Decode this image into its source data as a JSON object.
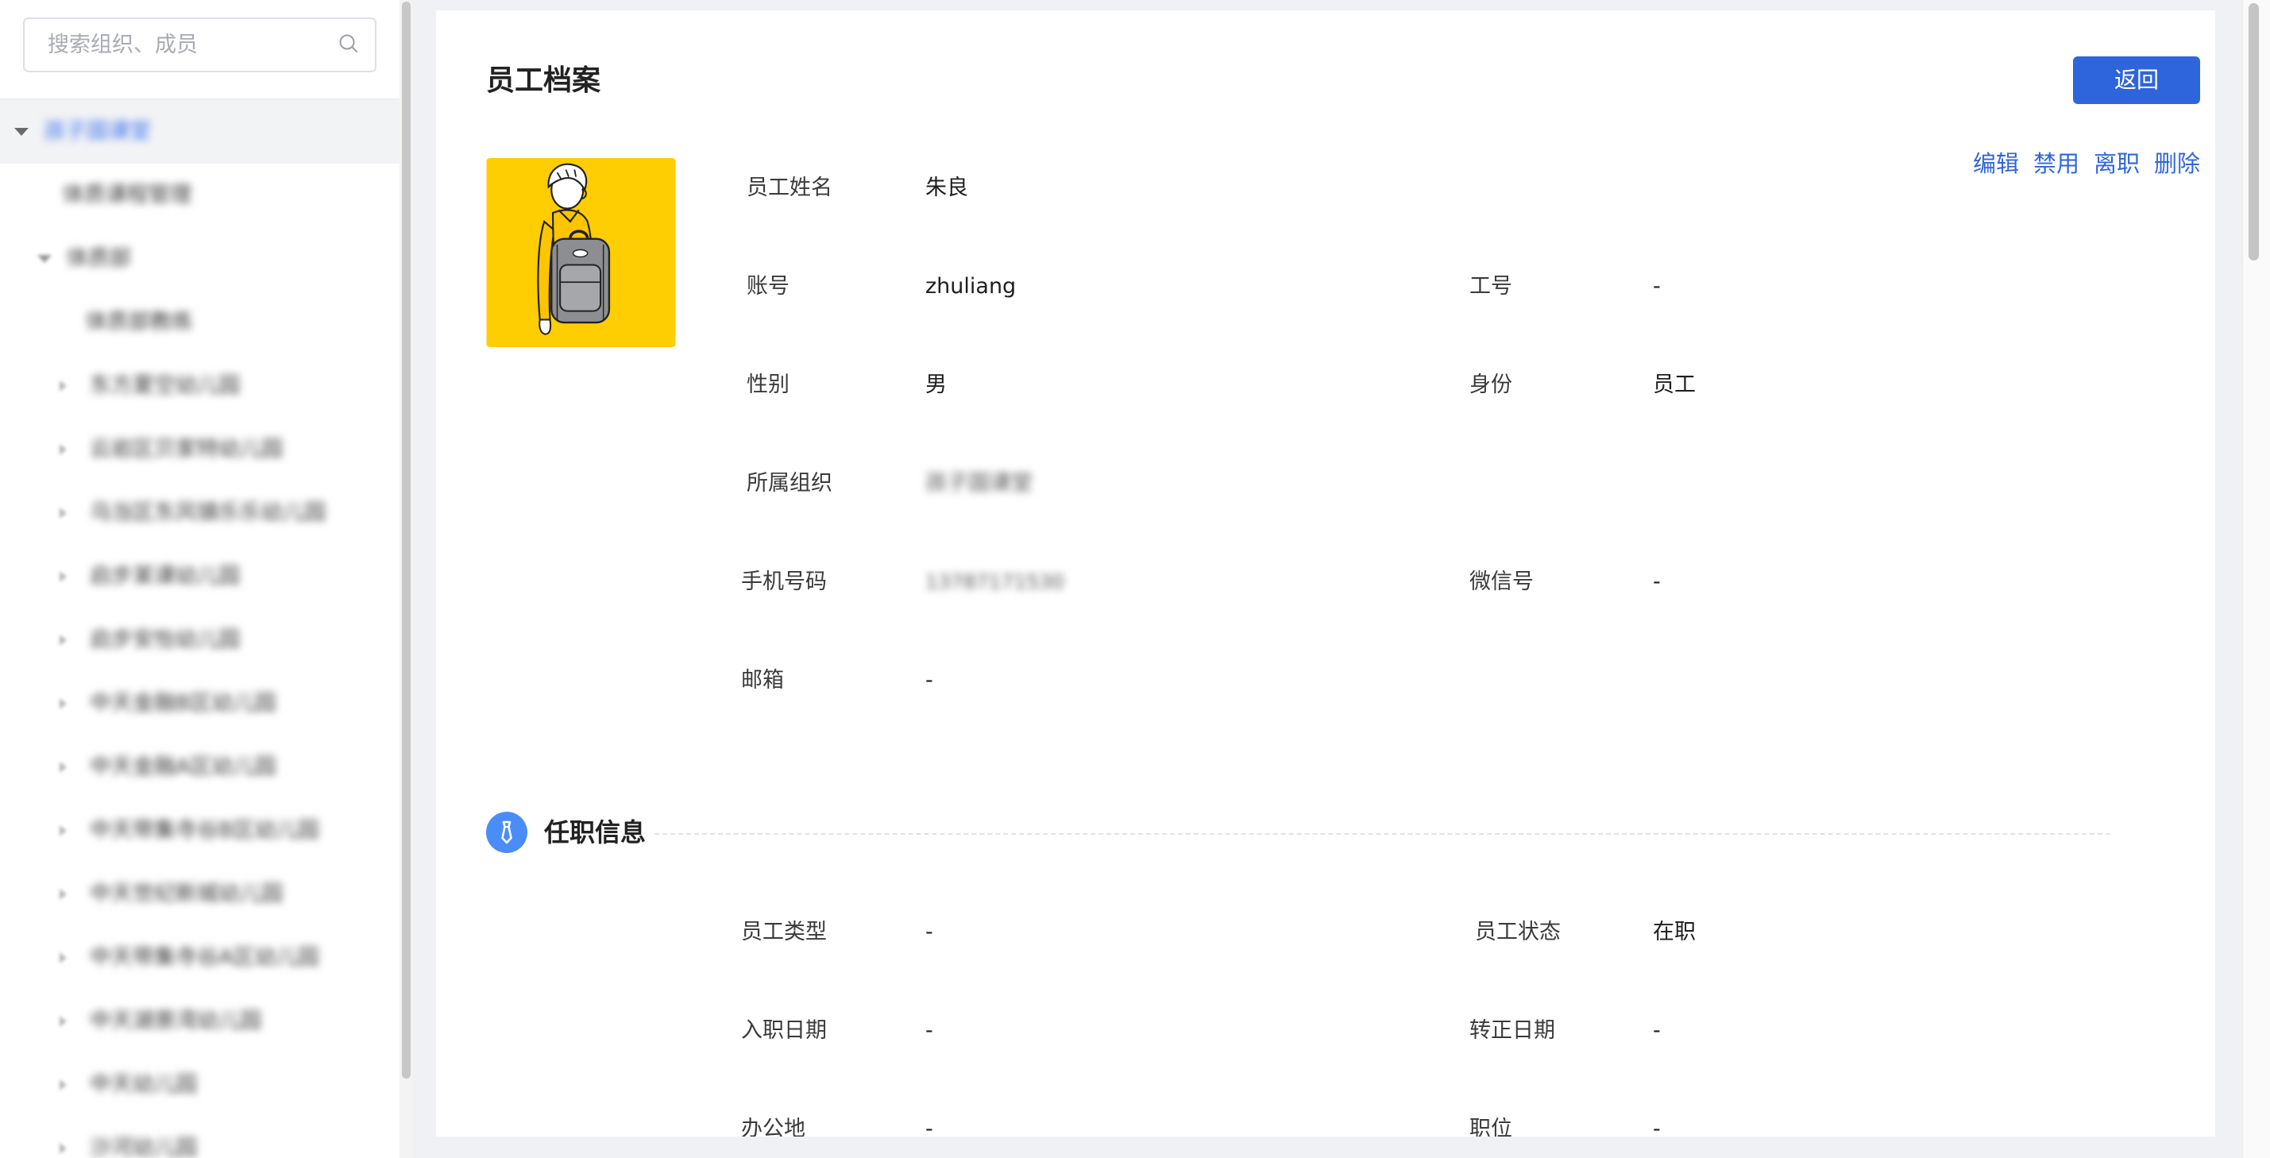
{
  "colors": {
    "primary": "#2f65dc",
    "section_icon": "#4b8df8",
    "avatar_bg": "#fecd02",
    "selected_node_text": "#3d72ee"
  },
  "sidebar": {
    "search": {
      "placeholder": "搜索组织、成员",
      "icon": "search-icon"
    },
    "tree": [
      {
        "label": "孩子国课堂",
        "level": 0,
        "has_children": true,
        "expanded": true,
        "selected": true
      },
      {
        "label": "体质课程管理",
        "level": 1,
        "has_children": false
      },
      {
        "label": "体质部",
        "level": 1,
        "has_children": true,
        "expanded": true
      },
      {
        "label": "体质部教练",
        "level": 2,
        "has_children": false
      },
      {
        "label": "东方夏空幼儿园",
        "level": 2,
        "has_children": true,
        "expanded": false
      },
      {
        "label": "云岩区贝家特幼儿园",
        "level": 2,
        "has_children": true,
        "expanded": false
      },
      {
        "label": "乌当区东风镇乐乐幼儿园",
        "level": 2,
        "has_children": true,
        "expanded": false
      },
      {
        "label": "启步某课幼儿园",
        "level": 2,
        "has_children": true,
        "expanded": false
      },
      {
        "label": "启步安怡幼儿园",
        "level": 2,
        "has_children": true,
        "expanded": false
      },
      {
        "label": "中天金融B区幼儿园",
        "level": 2,
        "has_children": true,
        "expanded": false
      },
      {
        "label": "中天金融A区幼儿园",
        "level": 2,
        "has_children": true,
        "expanded": false
      },
      {
        "label": "中天带集寺谷B区幼儿园",
        "level": 2,
        "has_children": true,
        "expanded": false
      },
      {
        "label": "中天世纪新城幼儿园",
        "level": 2,
        "has_children": true,
        "expanded": false
      },
      {
        "label": "中天带集寺谷A区幼儿园",
        "level": 2,
        "has_children": true,
        "expanded": false
      },
      {
        "label": "中天湖景湾幼儿园",
        "level": 2,
        "has_children": true,
        "expanded": false
      },
      {
        "label": "中天幼儿园",
        "level": 2,
        "has_children": true,
        "expanded": false
      },
      {
        "label": "沙河幼儿园",
        "level": 2,
        "has_children": true,
        "expanded": false
      }
    ]
  },
  "profile": {
    "title": "员工档案",
    "back_button": "返回",
    "actions": {
      "edit": "编辑",
      "disable": "禁用",
      "resign": "离职",
      "delete": "删除"
    },
    "avatar_icon": "avatar-illustration",
    "fields": {
      "name": {
        "label": "员工姓名",
        "value": "朱良"
      },
      "account": {
        "label": "账号",
        "value": "zhuliang"
      },
      "employee_no": {
        "label": "工号",
        "value": "-"
      },
      "gender": {
        "label": "性别",
        "value": "男"
      },
      "identity": {
        "label": "身份",
        "value": "员工"
      },
      "organization": {
        "label": "所属组织",
        "value": "孩子国课堂"
      },
      "phone": {
        "label": "手机号码",
        "value": "13787171530"
      },
      "wechat": {
        "label": "微信号",
        "value": "-"
      },
      "email": {
        "label": "邮箱",
        "value": "-"
      }
    }
  },
  "employment": {
    "title": "任职信息",
    "icon": "tie-icon",
    "fields": {
      "employee_type": {
        "label": "员工类型",
        "value": "-"
      },
      "employee_status": {
        "label": "员工状态",
        "value": "在职"
      },
      "hire_date": {
        "label": "入职日期",
        "value": "-"
      },
      "regularization_date": {
        "label": "转正日期",
        "value": "-"
      },
      "office": {
        "label": "办公地",
        "value": "-"
      },
      "position": {
        "label": "职位",
        "value": "-"
      }
    }
  }
}
